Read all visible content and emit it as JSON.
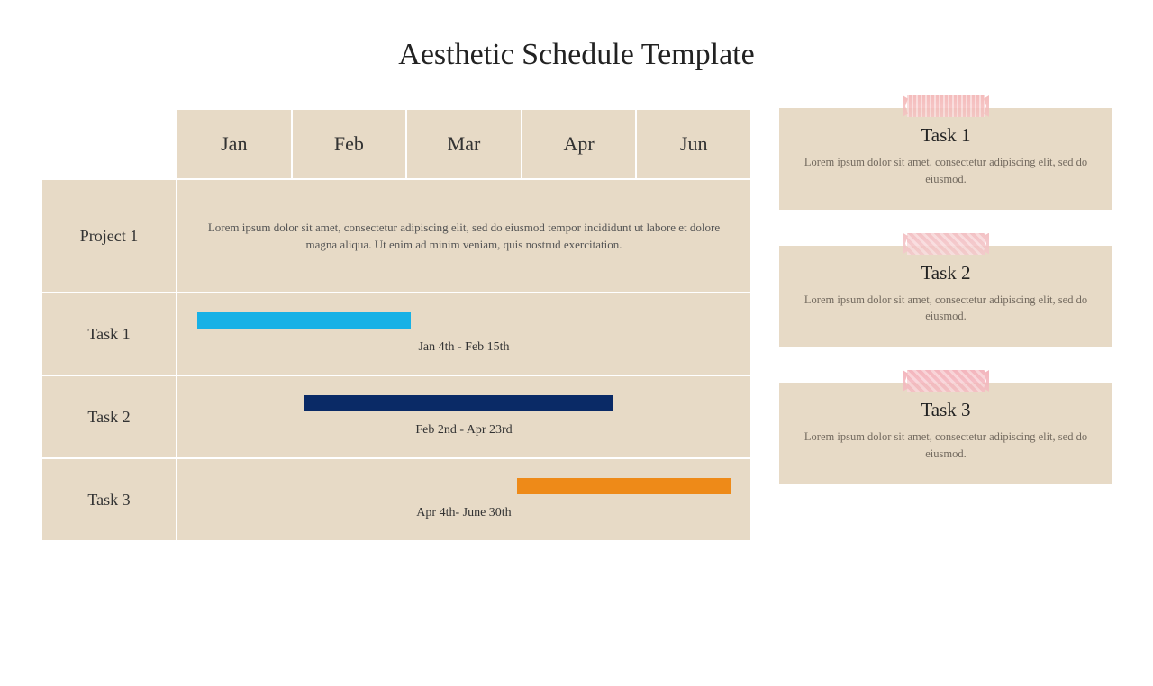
{
  "title": "Aesthetic Schedule Template",
  "months": [
    "Jan",
    "Feb",
    "Mar",
    "Apr",
    "Jun"
  ],
  "rows": {
    "project1": {
      "label": "Project 1",
      "description": "Lorem ipsum dolor sit amet, consectetur adipiscing elit, sed do eiusmod tempor incididunt ut labore et dolore magna aliqua. Ut enim ad minim veniam, quis nostrud exercitation."
    },
    "task1": {
      "label": "Task 1",
      "range_label": "Jan 4th - Feb 15th",
      "bar": {
        "color": "#17b1e6",
        "left_pct": 0,
        "width_pct": 40
      }
    },
    "task2": {
      "label": "Task 2",
      "range_label": "Feb 2nd - Apr 23rd",
      "bar": {
        "color": "#0a2a66",
        "left_pct": 20,
        "width_pct": 58
      }
    },
    "task3": {
      "label": "Task 3",
      "range_label": "Apr 4th- June 30th",
      "bar": {
        "color": "#ee8a18",
        "left_pct": 60,
        "width_pct": 40
      }
    }
  },
  "cards": {
    "c1": {
      "title": "Task 1",
      "body": "Lorem ipsum dolor sit amet, consectetur adipiscing elit, sed do eiusmod."
    },
    "c2": {
      "title": "Task 2",
      "body": "Lorem ipsum dolor sit amet, consectetur adipiscing elit, sed do eiusmod."
    },
    "c3": {
      "title": "Task 3",
      "body": "Lorem ipsum dolor sit amet, consectetur adipiscing elit, sed do eiusmod."
    }
  },
  "chart_data": {
    "type": "bar",
    "title": "Aesthetic Schedule Template",
    "categories": [
      "Jan",
      "Feb",
      "Mar",
      "Apr",
      "Jun"
    ],
    "series": [
      {
        "name": "Task 1",
        "start": "Jan 4th",
        "end": "Feb 15th",
        "color": "#17b1e6"
      },
      {
        "name": "Task 2",
        "start": "Feb 2nd",
        "end": "Apr 23rd",
        "color": "#0a2a66"
      },
      {
        "name": "Task 3",
        "start": "Apr 4th",
        "end": "June 30th",
        "color": "#ee8a18"
      }
    ],
    "xlabel": "",
    "ylabel": ""
  }
}
